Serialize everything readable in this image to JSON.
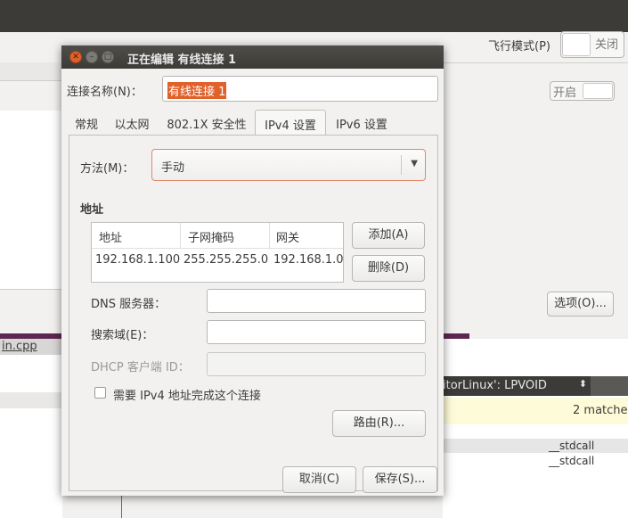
{
  "background": {
    "airplane_mode_label": "飞行模式(P)",
    "airplane_toggle_state": "关闭",
    "enable_toggle_state": "开启",
    "options_button": "选项(O)...",
    "file_tab_label": "in.cpp",
    "combo_text": "itorLinux': LPVOID",
    "matches_text": "2 matche",
    "stdcall_1": "__stdcall",
    "stdcall_2": "__stdcall"
  },
  "dialog": {
    "title": "正在编辑 有线连接 1",
    "connection_name_label": "连接名称(N)：",
    "connection_name_value": "有线连接 1",
    "tabs": [
      "常规",
      "以太网",
      "802.1X 安全性",
      "IPv4 设置",
      "IPv6 设置"
    ],
    "active_tab": "IPv4 设置",
    "method_label": "方法(M)：",
    "method_value": "手动",
    "address_heading": "地址",
    "address_table": {
      "columns": [
        "地址",
        "子网掩码",
        "网关"
      ],
      "rows": [
        [
          "192.168.1.100",
          "255.255.255.0",
          "192.168.1.0"
        ]
      ]
    },
    "add_button": "添加(A)",
    "delete_button": "删除(D)",
    "dns_label": "DNS 服务器：",
    "dns_value": "",
    "search_domain_label": "搜索域(E)：",
    "search_domain_value": "",
    "dhcp_client_id_label": "DHCP 客户端 ID：",
    "dhcp_client_id_value": "",
    "require_ipv4_label": "需要 IPv4 地址完成这个连接",
    "require_ipv4_checked": false,
    "routes_button": "路由(R)...",
    "cancel_button": "取消(C)",
    "save_button": "保存(S)..."
  },
  "colors": {
    "titlebar": "#3c3b37",
    "selection": "#e0612a",
    "close_button": "#e0612a",
    "highlight_row": "#fefcd8"
  }
}
